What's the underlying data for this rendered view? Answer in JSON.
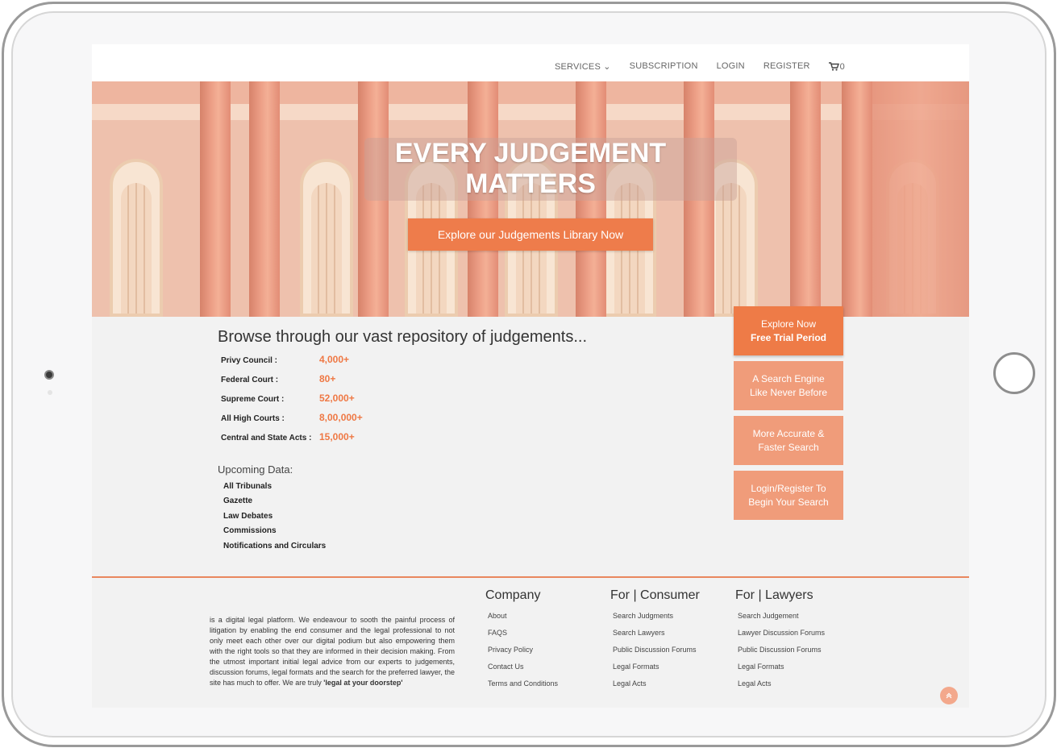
{
  "nav": {
    "items": [
      "SERVICES ⌄",
      "SUBSCRIPTION",
      "LOGIN",
      "REGISTER"
    ],
    "cart_count": "0"
  },
  "hero": {
    "title_line1": "EVERY JUDGEMENT",
    "title_line2": "MATTERS",
    "cta": "Explore our Judgements Library Now"
  },
  "browse": {
    "title": "Browse through our vast repository of judgements...",
    "stats": [
      {
        "label": "Privy Council :",
        "value": "4,000+"
      },
      {
        "label": "Federal Court :",
        "value": "80+"
      },
      {
        "label": "Supreme Court :",
        "value": "52,000+"
      },
      {
        "label": "All High Courts :",
        "value": "8,00,000+"
      },
      {
        "label": "Central and State Acts :",
        "value": "15,000+"
      }
    ],
    "upcoming_title": "Upcoming Data:",
    "upcoming": [
      "All Tribunals",
      "Gazette",
      "Law Debates",
      "Commissions",
      "Notifications and Circulars"
    ]
  },
  "side_buttons": [
    {
      "line1": "Explore Now",
      "line2": "Free Trial Period"
    },
    {
      "line1": "A Search Engine",
      "line2": "Like Never Before"
    },
    {
      "line1": "More Accurate &",
      "line2": "Faster Search"
    },
    {
      "line1": "Login/Register To",
      "line2": "Begin Your Search"
    }
  ],
  "footer": {
    "about": "is a digital legal platform. We endeavour to sooth the painful process of litigation by enabling the end consumer and the legal professional to not only meet each other over our digital podium but also empowering them with the right tools so that they are informed in their decision making. From the utmost important initial legal advice from our experts to judgements, discussion forums, legal formats and the search for the preferred lawyer, the site has much to offer. We are truly",
    "about_bold": "'legal at your doorstep'",
    "company": {
      "title": "Company",
      "links": [
        "About",
        "FAQS",
        "Privacy Policy",
        "Contact Us",
        "Terms and Conditions"
      ]
    },
    "consumer": {
      "title": "For | Consumer",
      "links": [
        "Search Judgments",
        "Search Lawyers",
        "Public Discussion Forums",
        "Legal Formats",
        "Legal Acts"
      ]
    },
    "lawyers": {
      "title": "For | Lawyers",
      "links": [
        "Search Judgement",
        "Lawyer Discussion Forums",
        "Public Discussion Forums",
        "Legal Formats",
        "Legal Acts"
      ]
    }
  },
  "colors": {
    "accent": "#ee7b47",
    "accent_light": "#f09c7a"
  },
  "icons": [
    "cart-icon",
    "chevron-up-icon"
  ]
}
